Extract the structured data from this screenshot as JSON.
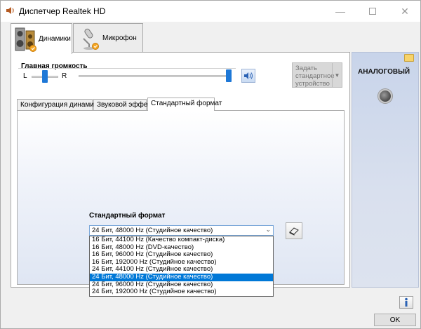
{
  "window": {
    "title": "Диспетчер Realtek HD"
  },
  "device_tabs": [
    {
      "label": "Динамики",
      "icon": "speakers-icon",
      "active": true
    },
    {
      "label": "Микрофон",
      "icon": "microphone-icon",
      "active": false
    }
  ],
  "volume": {
    "title": "Главная громкость",
    "left_label": "L",
    "right_label": "R",
    "balance": 0.5,
    "level": 1.0
  },
  "set_default_button": {
    "label_line1": "Задать",
    "label_line2": "стандартное",
    "label_line3": "устройство"
  },
  "inner_tabs": [
    {
      "label": "Конфигурация динамиков",
      "active": false
    },
    {
      "label": "Звуковой эффект",
      "active": false
    },
    {
      "label": "Стандартный формат",
      "active": true
    }
  ],
  "format": {
    "label": "Стандартный формат",
    "selected": "24 Бит, 48000 Hz (Студийное качество)",
    "options": [
      "16 Бит, 44100 Hz (Качество компакт-диска)",
      "16 Бит, 48000 Hz (DVD-качество)",
      "16 Бит, 96000 Hz (Студийное качество)",
      "16 Бит, 192000 Hz (Студийное качество)",
      "24 Бит, 44100 Hz (Студийное качество)",
      "24 Бит, 48000 Hz (Студийное качество)",
      "24 Бит, 96000 Hz (Студийное качество)",
      "24 Бит, 192000 Hz (Студийное качество)"
    ],
    "highlighted_index": 5
  },
  "right_panel": {
    "connector_label": "АНАЛОГОВЫЙ"
  },
  "footer": {
    "ok_label": "OK"
  },
  "colors": {
    "accent": "#0078d7",
    "slider": "#1e78d7",
    "right_panel": "#d0dbee"
  }
}
